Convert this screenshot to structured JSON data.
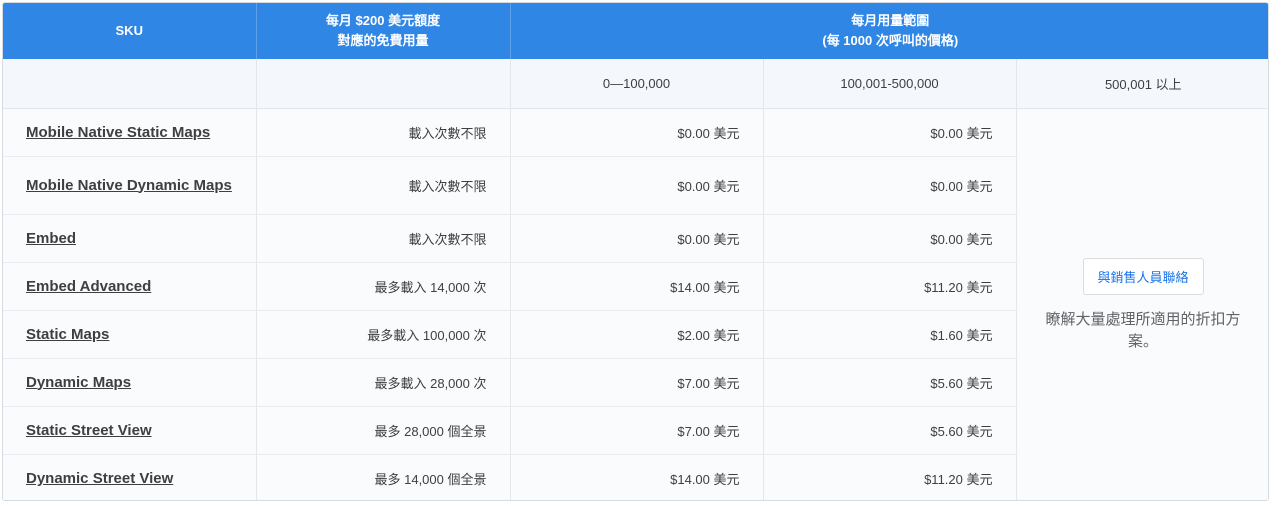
{
  "header": {
    "sku": "SKU",
    "free_line1": "每月 $200 美元額度",
    "free_line2": "對應的免費用量",
    "range_line1": "每月用量範圍",
    "range_line2": "(每 1000 次呼叫的價格)"
  },
  "subheader": {
    "tier1": "0—100,000",
    "tier2": "100,001-500,000",
    "tier3": "500,001 以上"
  },
  "rows": [
    {
      "sku": "Mobile Native Static Maps",
      "free": "載入次數不限",
      "tier1": "$0.00 美元",
      "tier2": "$0.00 美元"
    },
    {
      "sku": "Mobile Native Dynamic Maps",
      "free": "載入次數不限",
      "tier1": "$0.00 美元",
      "tier2": "$0.00 美元"
    },
    {
      "sku": "Embed",
      "free": "載入次數不限",
      "tier1": "$0.00 美元",
      "tier2": "$0.00 美元"
    },
    {
      "sku": "Embed Advanced",
      "free": "最多載入 14,000 次",
      "tier1": "$14.00 美元",
      "tier2": "$11.20 美元"
    },
    {
      "sku": "Static Maps",
      "free": "最多載入 100,000 次",
      "tier1": "$2.00 美元",
      "tier2": "$1.60 美元"
    },
    {
      "sku": "Dynamic Maps",
      "free": "最多載入 28,000 次",
      "tier1": "$7.00 美元",
      "tier2": "$5.60 美元"
    },
    {
      "sku": "Static Street View",
      "free": "最多 28,000 個全景",
      "tier1": "$7.00 美元",
      "tier2": "$5.60 美元"
    },
    {
      "sku": "Dynamic Street View",
      "free": "最多 14,000 個全景",
      "tier1": "$14.00 美元",
      "tier2": "$11.20 美元"
    }
  ],
  "contact": {
    "button_label": "與銷售人員聯絡",
    "note": "瞭解大量處理所適用的折扣方案。"
  }
}
